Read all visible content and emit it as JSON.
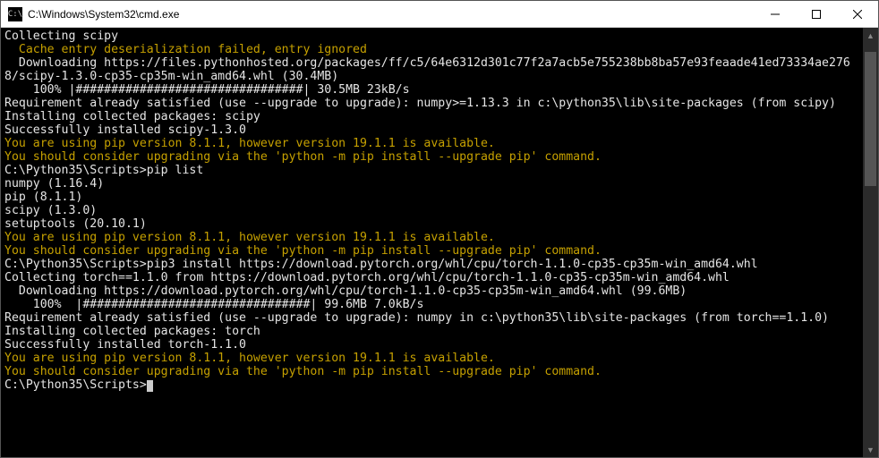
{
  "window": {
    "icon_label": "C:\\",
    "title": "C:\\Windows\\System32\\cmd.exe"
  },
  "lines": [
    {
      "cls": "c-white",
      "text": "Collecting scipy"
    },
    {
      "cls": "c-yellow",
      "text": "  Cache entry deserialization failed, entry ignored"
    },
    {
      "cls": "c-white",
      "text": "  Downloading https://files.pythonhosted.org/packages/ff/c5/64e6312d301c77f2a7acb5e755238bb8ba57e93feaade41ed73334ae2768/scipy-1.3.0-cp35-cp35m-win_amd64.whl (30.4MB)"
    },
    {
      "cls": "c-white",
      "text": "    100% |################################| 30.5MB 23kB/s"
    },
    {
      "cls": "c-white",
      "text": "Requirement already satisfied (use --upgrade to upgrade): numpy>=1.13.3 in c:\\python35\\lib\\site-packages (from scipy)"
    },
    {
      "cls": "c-white",
      "text": "Installing collected packages: scipy"
    },
    {
      "cls": "c-white",
      "text": "Successfully installed scipy-1.3.0"
    },
    {
      "cls": "c-yellow",
      "text": "You are using pip version 8.1.1, however version 19.1.1 is available."
    },
    {
      "cls": "c-yellow",
      "text": "You should consider upgrading via the 'python -m pip install --upgrade pip' command."
    },
    {
      "cls": "c-white",
      "text": ""
    },
    {
      "cls": "c-white",
      "text": "C:\\Python35\\Scripts>pip list"
    },
    {
      "cls": "c-white",
      "text": "numpy (1.16.4)"
    },
    {
      "cls": "c-white",
      "text": "pip (8.1.1)"
    },
    {
      "cls": "c-white",
      "text": "scipy (1.3.0)"
    },
    {
      "cls": "c-white",
      "text": "setuptools (20.10.1)"
    },
    {
      "cls": "c-yellow",
      "text": "You are using pip version 8.1.1, however version 19.1.1 is available."
    },
    {
      "cls": "c-yellow",
      "text": "You should consider upgrading via the 'python -m pip install --upgrade pip' command."
    },
    {
      "cls": "c-white",
      "text": ""
    },
    {
      "cls": "c-white",
      "text": "C:\\Python35\\Scripts>pip3 install https://download.pytorch.org/whl/cpu/torch-1.1.0-cp35-cp35m-win_amd64.whl"
    },
    {
      "cls": "c-white",
      "text": "Collecting torch==1.1.0 from https://download.pytorch.org/whl/cpu/torch-1.1.0-cp35-cp35m-win_amd64.whl"
    },
    {
      "cls": "c-white",
      "text": "  Downloading https://download.pytorch.org/whl/cpu/torch-1.1.0-cp35-cp35m-win_amd64.whl (99.6MB)"
    },
    {
      "cls": "c-white",
      "text": "    100%  |################################| 99.6MB 7.0kB/s"
    },
    {
      "cls": "c-white",
      "text": "Requirement already satisfied (use --upgrade to upgrade): numpy in c:\\python35\\lib\\site-packages (from torch==1.1.0)"
    },
    {
      "cls": "c-white",
      "text": "Installing collected packages: torch"
    },
    {
      "cls": "c-white",
      "text": "Successfully installed torch-1.1.0"
    },
    {
      "cls": "c-yellow",
      "text": "You are using pip version 8.1.1, however version 19.1.1 is available."
    },
    {
      "cls": "c-yellow",
      "text": "You should consider upgrading via the 'python -m pip install --upgrade pip' command."
    },
    {
      "cls": "c-white",
      "text": ""
    }
  ],
  "prompt": {
    "text": "C:\\Python35\\Scripts>"
  }
}
